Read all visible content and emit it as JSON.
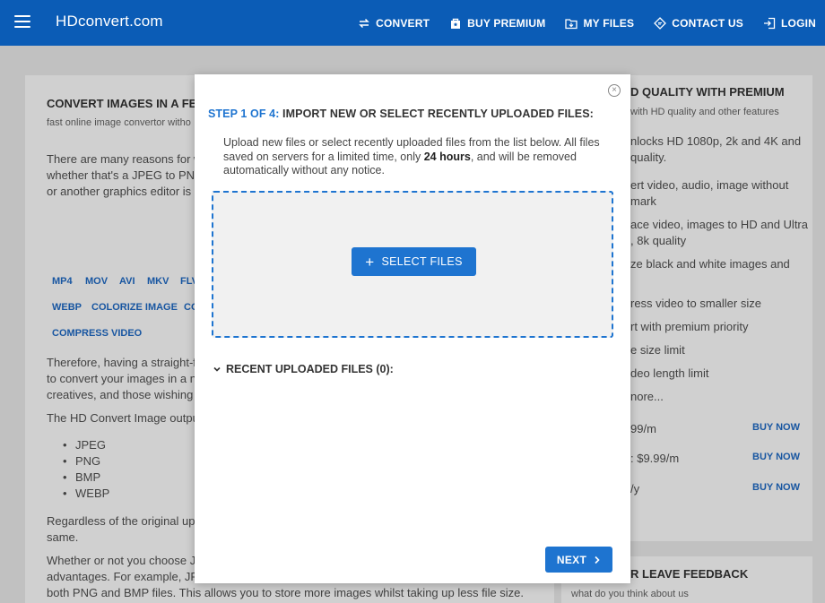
{
  "header": {
    "logo": "HDconvert.com",
    "nav": [
      {
        "label": "CONVERT",
        "icon": "convert-icon"
      },
      {
        "label": "BUY PREMIUM",
        "icon": "premium-bag-icon"
      },
      {
        "label": "MY FILES",
        "icon": "folder-icon"
      },
      {
        "label": "CONTACT US",
        "icon": "contact-icon"
      },
      {
        "label": "LOGIN",
        "icon": "login-icon"
      }
    ]
  },
  "background": {
    "left": {
      "title": "CONVERT IMAGES IN A FEW",
      "subtitle": "fast online image convertor witho",
      "intro": [
        "There are many reasons for w",
        "whether that's a JPEG to PNG",
        "or another graphics editor is"
      ],
      "tags_row1": [
        "MP4",
        "MOV",
        "AVI",
        "MKV",
        "FLV"
      ],
      "tags_row2": [
        "WEBP",
        "COLORIZE IMAGE",
        "CO"
      ],
      "tags_row3": [
        "COMPRESS VIDEO"
      ],
      "para2": [
        "Therefore, having a straight-f",
        "to convert your images in a n",
        "creatives, and those wishing"
      ],
      "output_intro": "The HD Convert Image outpu",
      "formats": [
        "JPEG",
        "PNG",
        "BMP",
        "WEBP"
      ],
      "para3": [
        "Regardless of the original up",
        "same."
      ],
      "para4": [
        "Whether or not you choose J",
        "advantages. For example, JP",
        "both PNG and BMP files. This allows you to store more images whilst taking up less file size."
      ]
    },
    "right": {
      "title": "D QUALITY WITH PREMIUM",
      "subtitle": "with HD quality and other features",
      "features": [
        "nlocks HD 1080p, 2k and 4K and",
        "quality.",
        "ert video, audio, image without",
        "mark",
        "ace video, images to HD and Ultra",
        ", 8k quality",
        "ze black and white images and",
        "ress video to smaller size",
        "rt with premium priority",
        "e size limit",
        "deo length limit",
        "nore..."
      ],
      "prices": [
        "99/m",
        ": $9.99/m",
        "/y"
      ],
      "buy_label": "BUY NOW",
      "feedback_title": "R LEAVE FEEDBACK",
      "feedback_sub": "what do you think about us"
    }
  },
  "modal": {
    "step_num": "STEP 1 OF 4:",
    "step_title": " IMPORT NEW OR SELECT RECENTLY UPLOADED FILES:",
    "desc_before": "Upload new files or select recently uploaded files from the list below. All files saved on servers for a limited time, only ",
    "desc_bold": "24 hours",
    "desc_after": ", and will be removed automatically without any notice.",
    "select_files": "SELECT FILES",
    "recent_label": "RECENT UPLOADED FILES (0):",
    "next_label": "NEXT"
  },
  "colors": {
    "header": "#0b5cb6",
    "accent": "#1e74d0"
  }
}
